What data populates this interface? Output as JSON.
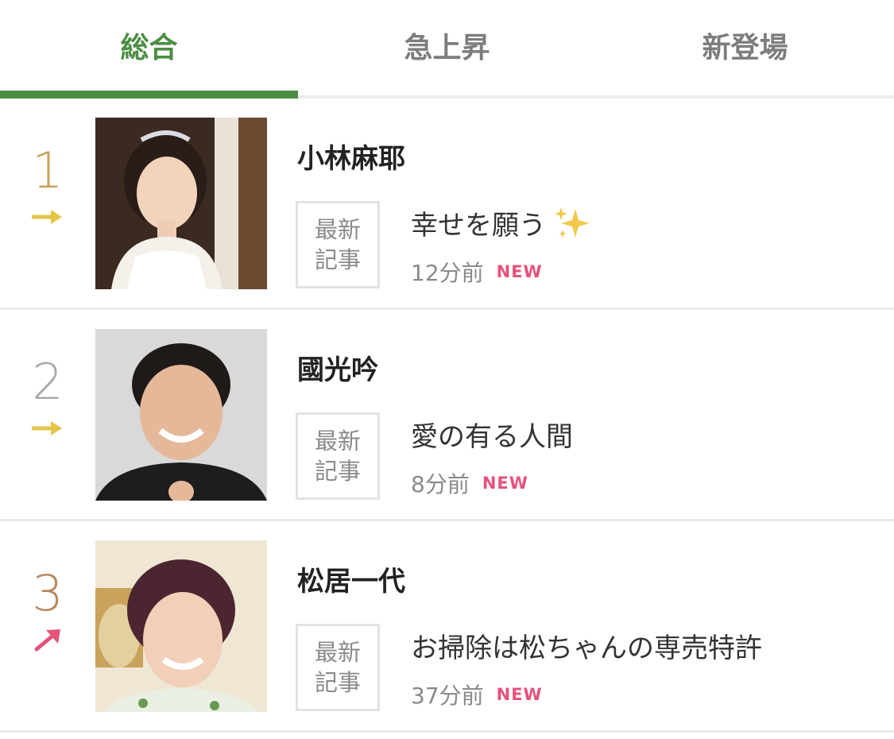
{
  "tabs": [
    {
      "label": "総合",
      "active": true
    },
    {
      "label": "急上昇",
      "active": false
    },
    {
      "label": "新登場",
      "active": false
    }
  ],
  "colors": {
    "accent": "#4c8d44",
    "rank_gold": "#c9a15a",
    "rank_gray": "#a9a9a9",
    "rank_bronze": "#b8875b",
    "arrow_flat": "#e5c548",
    "arrow_up": "#e5527a",
    "new_badge": "#e5527a"
  },
  "ranking": [
    {
      "rank": "1",
      "trend": "flat",
      "trend_icon": "arrow-right-icon",
      "name": "小林麻耶",
      "tag_line1": "最新",
      "tag_line2": "記事",
      "title": "幸せを願う",
      "title_emoji": "sparkles-icon",
      "time": "12分前",
      "badge": "NEW"
    },
    {
      "rank": "2",
      "trend": "flat",
      "trend_icon": "arrow-right-icon",
      "name": "國光吟",
      "tag_line1": "最新",
      "tag_line2": "記事",
      "title": "愛の有る人間",
      "time": "8分前",
      "badge": "NEW"
    },
    {
      "rank": "3",
      "trend": "up",
      "trend_icon": "arrow-up-right-icon",
      "name": "松居一代",
      "tag_line1": "最新",
      "tag_line2": "記事",
      "title": "お掃除は松ちゃんの専売特許",
      "time": "37分前",
      "badge": "NEW"
    }
  ]
}
